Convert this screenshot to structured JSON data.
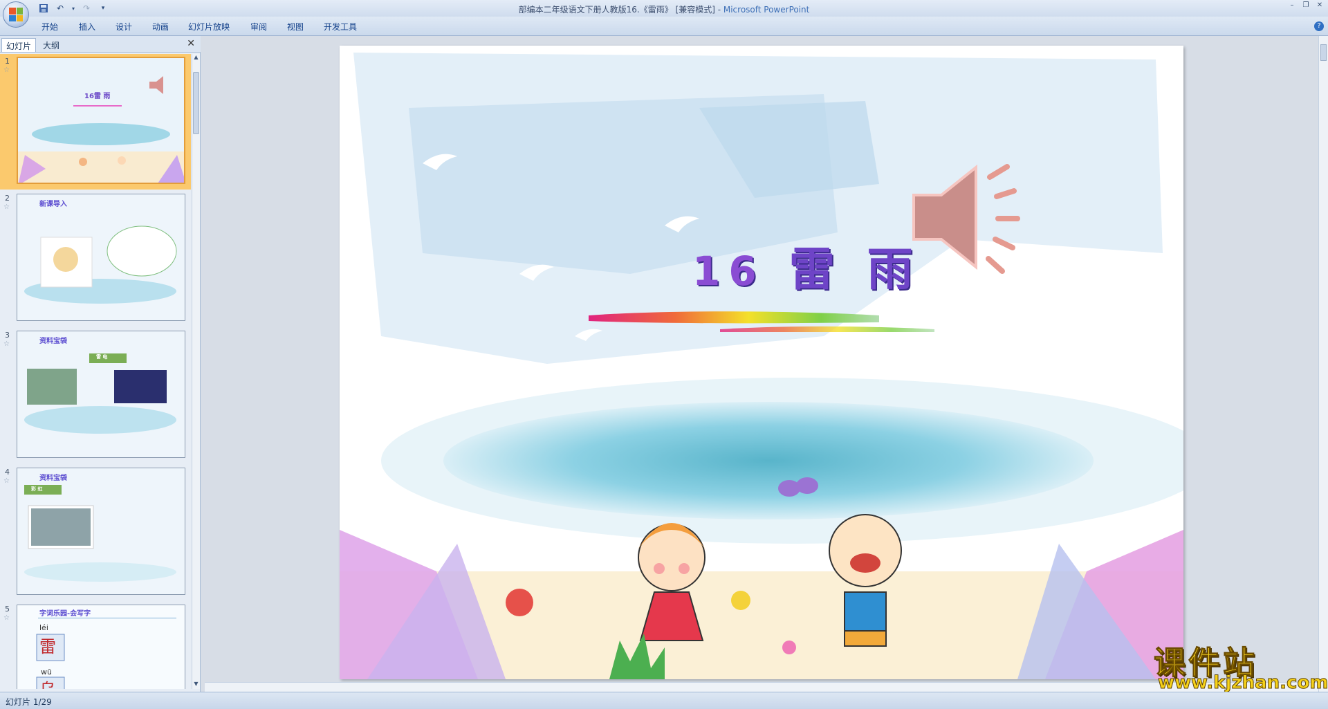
{
  "window": {
    "title": "部编本二年级语文下册人教版16.《雷雨》 [兼容模式] - ",
    "app_name": "Microsoft PowerPoint"
  },
  "ribbon": {
    "tabs": [
      "开始",
      "插入",
      "设计",
      "动画",
      "幻灯片放映",
      "审阅",
      "视图",
      "开发工具"
    ]
  },
  "left_pane": {
    "tab_slides": "幻灯片",
    "tab_outline": "大纲",
    "close": "✕"
  },
  "thumbnails": [
    {
      "num": "1",
      "title": "16雷  雨"
    },
    {
      "num": "2",
      "title": "新课导入"
    },
    {
      "num": "3",
      "title": "资料宝袋",
      "sub": "雷 电"
    },
    {
      "num": "4",
      "title": "资料宝袋",
      "sub": "彩 虹"
    },
    {
      "num": "5",
      "title": "字词乐园-会写字",
      "pinyin1": "léi",
      "char1": "雷",
      "pinyin2": "wū",
      "char2": "乌"
    }
  ],
  "slide": {
    "number": "16",
    "title": "雷  雨"
  },
  "status": {
    "slide_counter": "幻灯片 1/29"
  },
  "watermark": {
    "text": "课件站",
    "url": "www.kjzhan.com"
  },
  "colors": {
    "accent": "#15428b",
    "selected_thumb": "#fbc96d",
    "title_purple": "#6e44c7"
  }
}
